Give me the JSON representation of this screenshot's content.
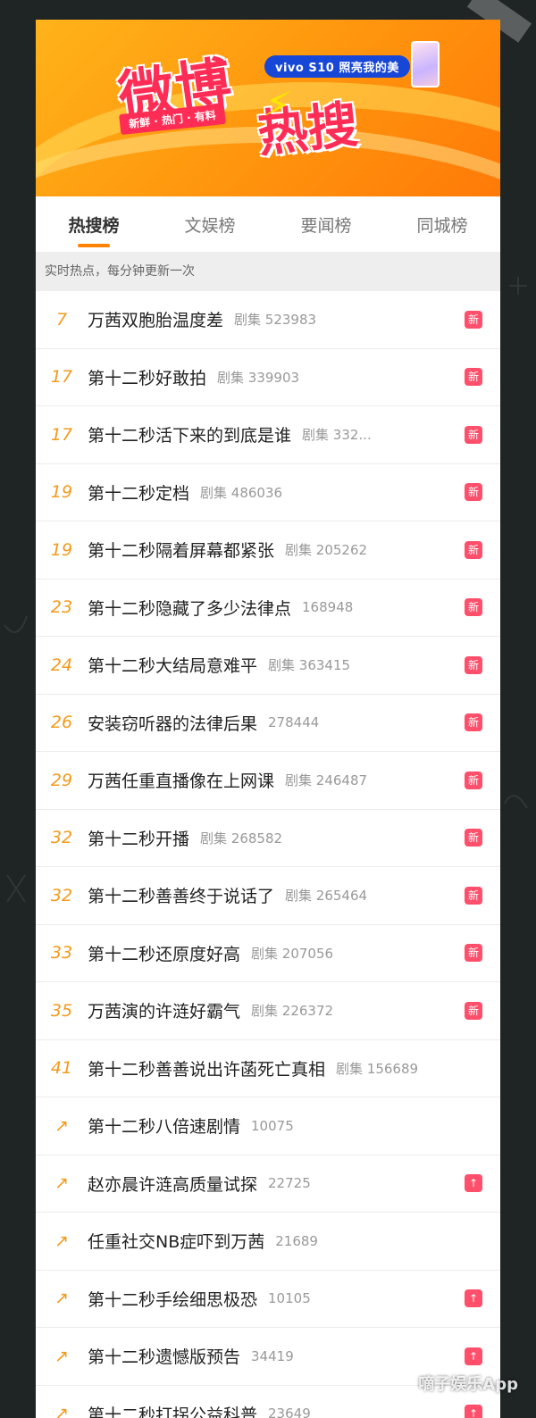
{
  "banner": {
    "logo_top": "微博",
    "logo_bottom": "热搜",
    "tagline": "新鲜 · 热门 · 有料",
    "ad_text": "vivo S10 照亮我的美"
  },
  "tabs": [
    {
      "label": "热搜榜",
      "active": true
    },
    {
      "label": "文娱榜",
      "active": false
    },
    {
      "label": "要闻榜",
      "active": false
    },
    {
      "label": "同城榜",
      "active": false
    }
  ],
  "subtitle": "实时热点，每分钟更新一次",
  "rows": [
    {
      "rank": "7",
      "title": "万茜双胞胎温度差",
      "meta": "剧集 523983",
      "badge": "新"
    },
    {
      "rank": "17",
      "title": "第十二秒好敢拍",
      "meta": "剧集 339903",
      "badge": "新"
    },
    {
      "rank": "17",
      "title": "第十二秒活下来的到底是谁",
      "meta": "剧集 332...",
      "badge": "新"
    },
    {
      "rank": "19",
      "title": "第十二秒定档",
      "meta": "剧集 486036",
      "badge": "新"
    },
    {
      "rank": "19",
      "title": "第十二秒隔着屏幕都紧张",
      "meta": "剧集 205262",
      "badge": "新"
    },
    {
      "rank": "23",
      "title": "第十二秒隐藏了多少法律点",
      "meta": "168948",
      "badge": "新"
    },
    {
      "rank": "24",
      "title": "第十二秒大结局意难平",
      "meta": "剧集 363415",
      "badge": "新"
    },
    {
      "rank": "26",
      "title": "安装窃听器的法律后果",
      "meta": "278444",
      "badge": "新"
    },
    {
      "rank": "29",
      "title": "万茜任重直播像在上网课",
      "meta": "剧集 246487",
      "badge": "新"
    },
    {
      "rank": "32",
      "title": "第十二秒开播",
      "meta": "剧集 268582",
      "badge": "新"
    },
    {
      "rank": "32",
      "title": "第十二秒善善终于说话了",
      "meta": "剧集 265464",
      "badge": "新"
    },
    {
      "rank": "33",
      "title": "第十二秒还原度好高",
      "meta": "剧集 207056",
      "badge": "新"
    },
    {
      "rank": "35",
      "title": "万茜演的许涟好霸气",
      "meta": "剧集 226372",
      "badge": "新"
    },
    {
      "rank": "41",
      "title": "第十二秒善善说出许菡死亡真相",
      "meta": "剧集 156689",
      "badge": ""
    },
    {
      "rank": "↗",
      "title": "第十二秒八倍速剧情",
      "meta": "10075",
      "badge": ""
    },
    {
      "rank": "↗",
      "title": "赵亦晨许涟高质量试探",
      "meta": "22725",
      "badge": "↑"
    },
    {
      "rank": "↗",
      "title": "任重社交NB症吓到万茜",
      "meta": "21689",
      "badge": ""
    },
    {
      "rank": "↗",
      "title": "第十二秒手绘细思极恐",
      "meta": "10105",
      "badge": "↑"
    },
    {
      "rank": "↗",
      "title": "第十二秒遗憾版预告",
      "meta": "34419",
      "badge": "↑"
    },
    {
      "rank": "↗",
      "title": "第十二秒打拐公益科普",
      "meta": "23649",
      "badge": "↑"
    }
  ],
  "watermark": "嘀子娱乐App",
  "colors": {
    "accent": "#ff8200",
    "rank": "#f39a1b",
    "badge": "#ff4f6b"
  }
}
